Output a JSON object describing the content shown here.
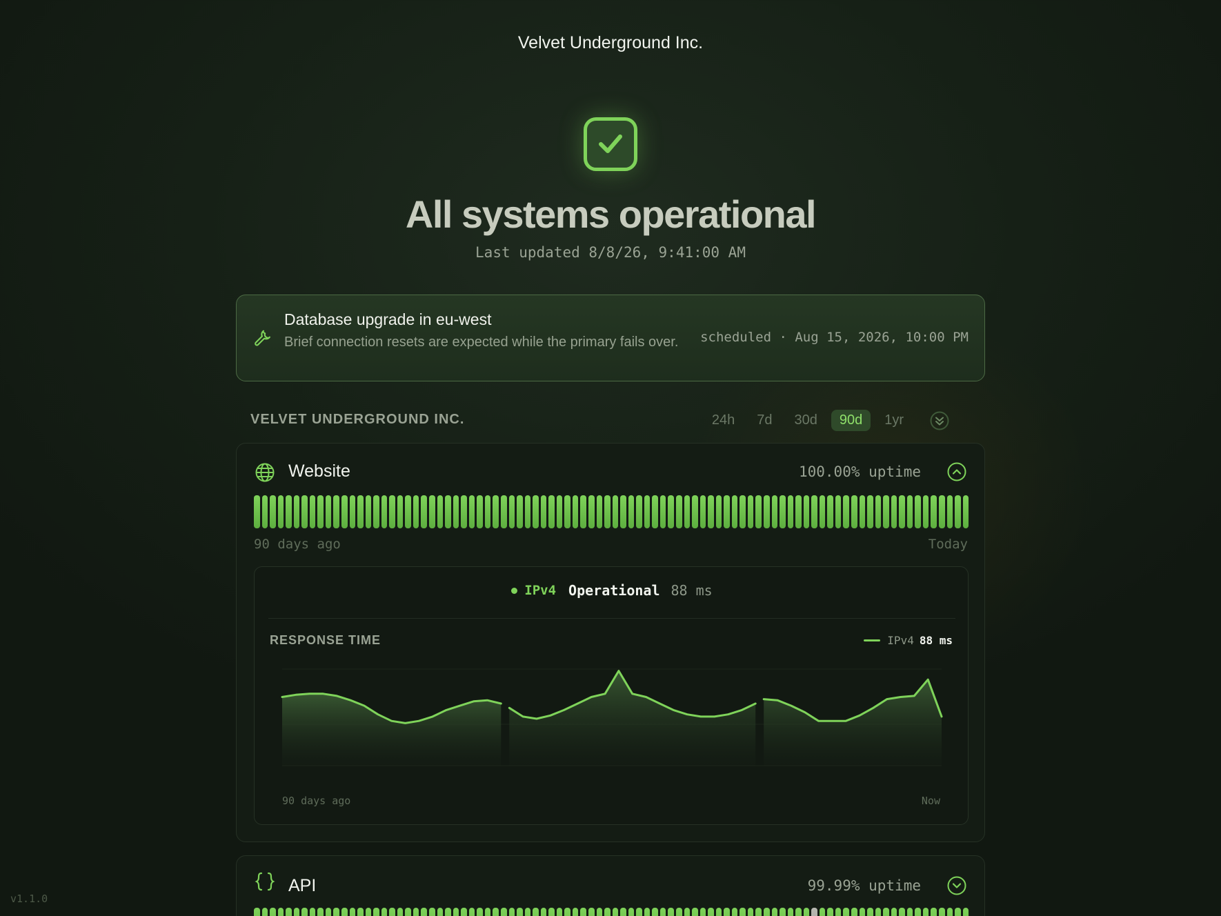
{
  "page": {
    "company": "Velvet Underground Inc.",
    "title": "All systems operational",
    "last_updated": "Last updated 8/8/26, 9:41:00 AM",
    "version": "v1.1.0"
  },
  "maintenance": {
    "icon": "wrench-icon",
    "title": "Database upgrade in eu-west",
    "description": "Brief connection resets are expected while the primary fails over.",
    "schedule": "scheduled · Aug 15, 2026, 10:00 PM"
  },
  "group": {
    "label": "VELVET UNDERGROUND INC.",
    "ranges": [
      "24h",
      "7d",
      "30d",
      "90d",
      "1yr"
    ],
    "active_range": "90d"
  },
  "services": {
    "website": {
      "icon": "globe-icon",
      "name": "Website",
      "uptime": "100.00% uptime",
      "expanded": true,
      "days_total": 90,
      "degraded_days": [],
      "label_start": "90 days ago",
      "label_end": "Today",
      "detail": {
        "protocol": "IPv4",
        "status": "Operational",
        "latency": "88 ms",
        "chart_title": "RESPONSE TIME",
        "legend_name": "IPv4",
        "legend_value": "88 ms",
        "axis_start": "90 days ago",
        "axis_end": "Now"
      }
    },
    "api": {
      "icon": "braces-icon",
      "name": "API",
      "uptime": "99.99% uptime",
      "expanded": false,
      "days_total": 90,
      "degraded_days": [
        70
      ]
    }
  },
  "chart_data": {
    "type": "area",
    "series": [
      {
        "name": "IPv4",
        "values": [
          89,
          90,
          90.5,
          90.5,
          89.5,
          87.5,
          85,
          81,
          78,
          77,
          78,
          80,
          83,
          85,
          87,
          87.5,
          86,
          84,
          80,
          79,
          80.5,
          83,
          86,
          89,
          90.5,
          101,
          90.5,
          89,
          86,
          83,
          81,
          80,
          80,
          81,
          83,
          86,
          88,
          87.5,
          85,
          82,
          78,
          78,
          78,
          80.5,
          84,
          88,
          89,
          89.5,
          97,
          80
        ]
      }
    ],
    "gaps_after_index": [
      16,
      35
    ],
    "ylim": [
      60,
      105
    ],
    "colors": {
      "line": "#7fd35a",
      "area_top": "#3a5a33"
    }
  },
  "colors": {
    "accent": "#7fd35a",
    "operational": "#7fd35a",
    "degraded": "#b9b9b2",
    "background": "#151e15"
  }
}
